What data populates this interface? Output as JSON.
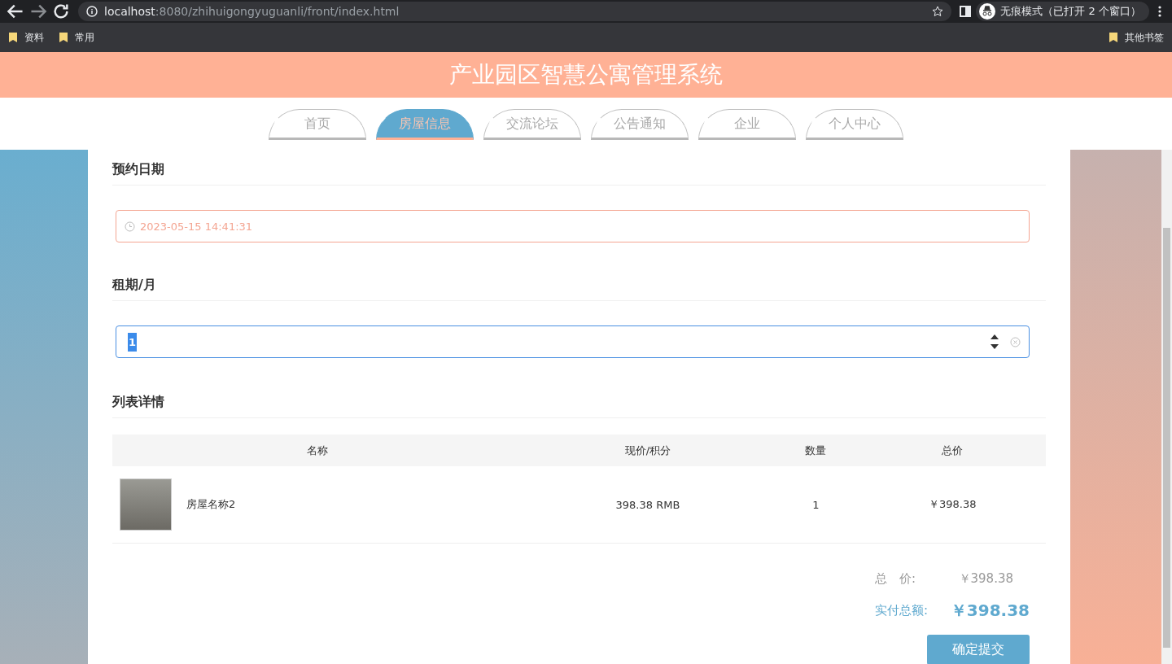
{
  "browser": {
    "url_host": "localhost",
    "url_rest": ":8080/zhihuigongyuguanli/front/index.html",
    "incognito": "无痕模式（已打开 2 个窗口）",
    "bookmarks": [
      "资料",
      "常用"
    ],
    "other_bookmarks": "其他书签"
  },
  "header": {
    "title": "产业园区智慧公寓管理系统"
  },
  "nav": [
    {
      "label": "首页",
      "selected": false
    },
    {
      "label": "房屋信息",
      "selected": true
    },
    {
      "label": "交流论坛",
      "selected": false
    },
    {
      "label": "公告通知",
      "selected": false
    },
    {
      "label": "企业",
      "selected": false
    },
    {
      "label": "个人中心",
      "selected": false
    }
  ],
  "booking_date": {
    "label": "预约日期",
    "value": "2023-05-15 14:41:31"
  },
  "lease_months": {
    "label": "租期/月",
    "value": "1"
  },
  "details": {
    "label": "列表详情",
    "columns": [
      "名称",
      "现价/积分",
      "数量",
      "总价"
    ],
    "rows": [
      {
        "name": "房屋名称2",
        "price": "398.38 RMB",
        "quantity": "1",
        "total": "￥398.38"
      }
    ]
  },
  "summary": {
    "total_label": "总　价:",
    "total": "￥398.38",
    "paid_label": "实付总额:",
    "paid": "￥398.38",
    "submit": "确定提交"
  }
}
